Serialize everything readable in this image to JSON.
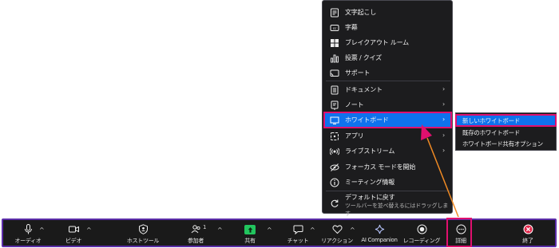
{
  "more_menu": {
    "items": [
      {
        "label": "文字起こし",
        "icon": "transcript-icon"
      },
      {
        "label": "字幕",
        "icon": "cc-icon"
      },
      {
        "label": "ブレイクアウト ルーム",
        "icon": "breakout-rooms-icon"
      },
      {
        "label": "投票 / クイズ",
        "icon": "poll-icon"
      },
      {
        "label": "サポート",
        "icon": "support-icon"
      },
      {
        "label": "ドキュメント",
        "icon": "document-icon",
        "has_submenu": true
      },
      {
        "label": "ノート",
        "icon": "notes-icon",
        "has_submenu": true
      },
      {
        "label": "ホワイトボード",
        "icon": "whiteboard-icon",
        "has_submenu": true,
        "active": true
      },
      {
        "label": "アプリ",
        "icon": "apps-icon",
        "has_submenu": true
      },
      {
        "label": "ライブストリーム",
        "icon": "livestream-icon",
        "has_submenu": true
      },
      {
        "label": "フォーカス モードを開始",
        "icon": "focus-mode-icon"
      },
      {
        "label": "ミーティング情報",
        "icon": "info-icon"
      }
    ],
    "reset": {
      "label": "デフォルトに戻す",
      "sub": "ツールバーを並べ替えるにはドラッグします",
      "icon": "reset-icon"
    },
    "chevron": "›"
  },
  "whiteboard_submenu": {
    "items": [
      {
        "label": "新しいホワイトボード",
        "selected": true
      },
      {
        "label": "既存のホワイトボード"
      },
      {
        "label": "ホワイトボード共有オプション"
      }
    ]
  },
  "toolbar": {
    "audio": "オーディオ",
    "video": "ビデオ",
    "host_tools": "ホストツール",
    "participants": "参加者",
    "participants_count": "1",
    "share": "共有",
    "chat": "チャット",
    "reactions": "リアクション",
    "ai_companion": "AI Companion",
    "recording": "レコーディング",
    "more": "詳細",
    "end": "終了",
    "caret": "^"
  },
  "colors": {
    "accent_blue": "#0e72ed",
    "highlight_pink": "#e0106e",
    "toolbar_border": "#5b2da8",
    "share_green": "#22c55e",
    "end_red": "#e0264a"
  }
}
